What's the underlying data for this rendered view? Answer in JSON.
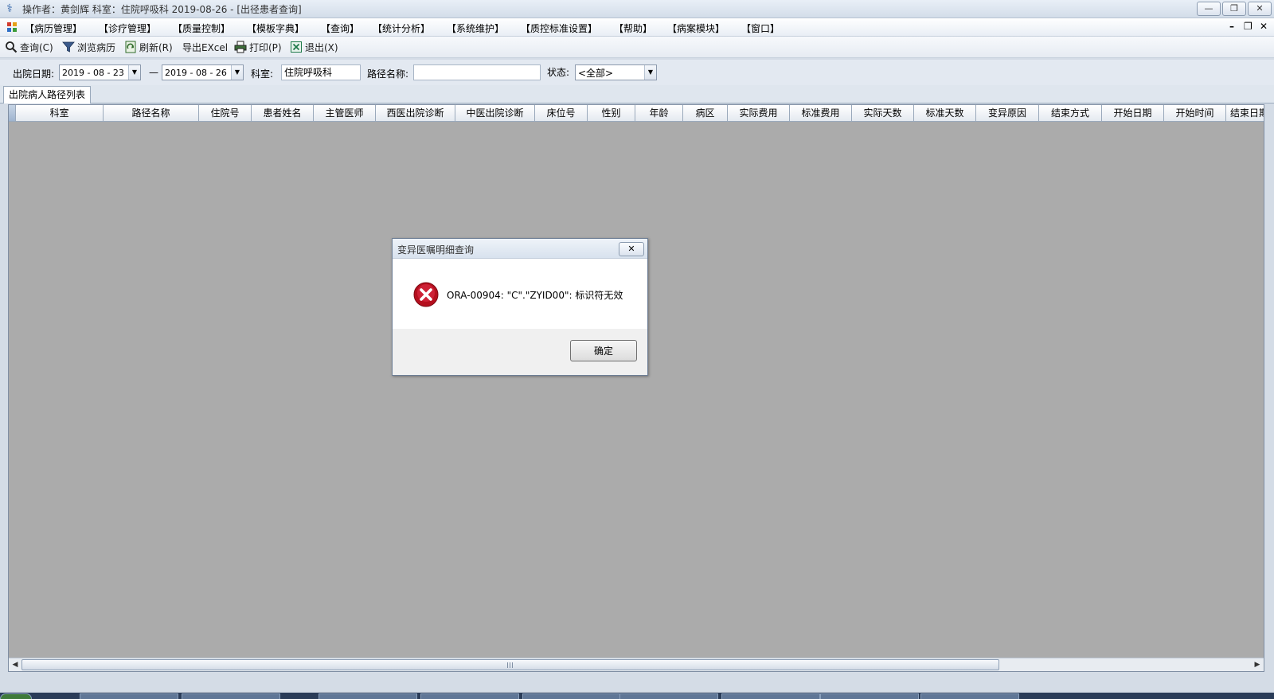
{
  "window": {
    "title": "操作者：黄剑辉  科室：住院呼吸科  2019-08-26 - [出径患者查询]",
    "minimize": "—",
    "restore": "❐",
    "close": "✕"
  },
  "menu": {
    "items": [
      "【病历管理】",
      "【诊疗管理】",
      "【质量控制】",
      "【模板字典】",
      "【查询】",
      "【统计分析】",
      "【系统维护】",
      "【质控标准设置】",
      "【帮助】",
      "【病案模块】",
      "【窗口】"
    ],
    "mdi_min": "–",
    "mdi_restore": "❐",
    "mdi_close": "✕"
  },
  "toolbar": {
    "query": "查询(C)",
    "browse": "浏览病历",
    "refresh": "刷新(R)",
    "export": "导出EXcel",
    "print": "打印(P)",
    "exit": "退出(X)"
  },
  "filters": {
    "discharge_date_label": "出院日期:",
    "date_from": "2019 - 08 - 23",
    "date_sep": "—",
    "date_to": "2019 - 08 - 26",
    "dept_label": "科室:",
    "dept_value": "住院呼吸科",
    "path_name_label": "路径名称:",
    "path_name_value": "",
    "status_label": "状态:",
    "status_value": "<全部>"
  },
  "tab": {
    "label": "出院病人路径列表"
  },
  "grid": {
    "columns": [
      "科室",
      "路径名称",
      "住院号",
      "患者姓名",
      "主管医师",
      "西医出院诊断",
      "中医出院诊断",
      "床位号",
      "性别",
      "年龄",
      "病区",
      "实际费用",
      "标准费用",
      "实际天数",
      "标准天数",
      "变异原因",
      "结束方式",
      "开始日期",
      "开始时间",
      "结束日期"
    ]
  },
  "dialog": {
    "title": "变异医嘱明细查询",
    "message": "ORA-00904: \"C\".\"ZYID00\": 标识符无效",
    "ok": "确定",
    "close": "✕"
  },
  "colors": {
    "grid_background": "#ababab",
    "error_red": "#c8102e"
  }
}
